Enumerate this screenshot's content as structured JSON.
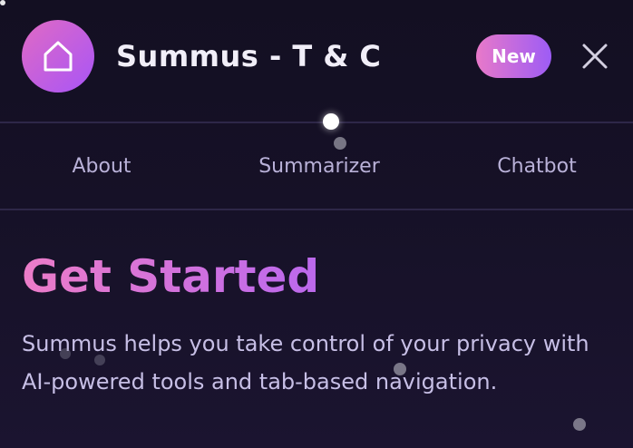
{
  "header": {
    "title": "Summus - T & C",
    "logo_icon": "home-icon",
    "badge": "New",
    "close_icon": "close-icon"
  },
  "nav": {
    "tabs": [
      {
        "label": "About"
      },
      {
        "label": "Summarizer"
      },
      {
        "label": "Chatbot"
      }
    ],
    "active": "Summarizer"
  },
  "main": {
    "heading": "Get Started",
    "description": "Summus helps you take control of your privacy with AI-powered tools and tab-based navigation."
  },
  "colors": {
    "background": "#151026",
    "accent_pink": "#e879c9",
    "accent_purple": "#9d5cf5",
    "nav_text": "#b9b1d8",
    "body_text": "#c7bfe6"
  }
}
